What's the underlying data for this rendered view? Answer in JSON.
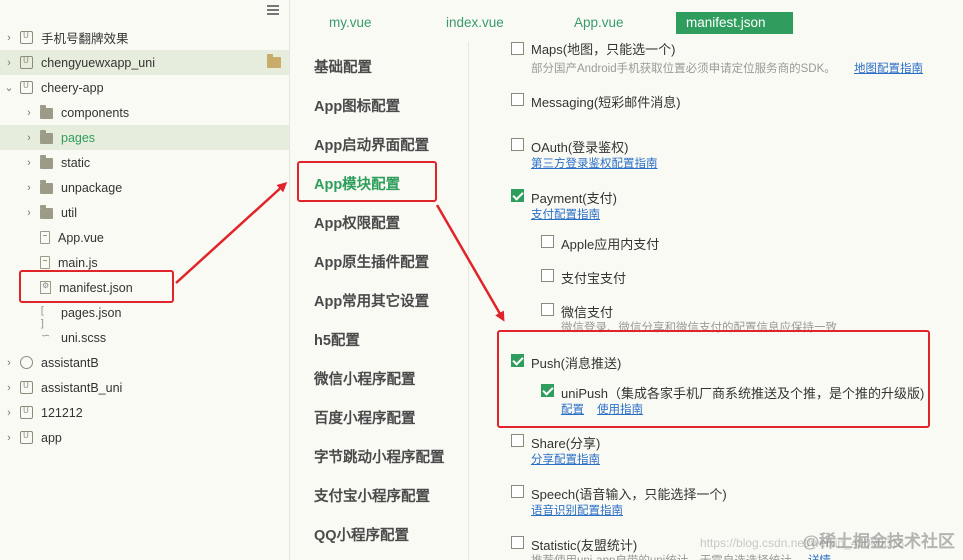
{
  "tree": {
    "items": [
      {
        "label": "手机号翻牌效果",
        "icon": "project-icon",
        "expanded": false
      },
      {
        "label": "chengyuewxapp_uni",
        "icon": "project-icon",
        "expanded": false
      },
      {
        "label": "cheery-app",
        "icon": "project-icon",
        "expanded": true
      },
      {
        "label": "components",
        "icon": "folder-icon"
      },
      {
        "label": "pages",
        "icon": "folder-icon"
      },
      {
        "label": "static",
        "icon": "folder-icon"
      },
      {
        "label": "unpackage",
        "icon": "folder-icon"
      },
      {
        "label": "util",
        "icon": "folder-icon"
      },
      {
        "label": "App.vue",
        "icon": "vue-file-icon"
      },
      {
        "label": "main.js",
        "icon": "js-file-icon"
      },
      {
        "label": "manifest.json",
        "icon": "manifest-file-icon"
      },
      {
        "label": "pages.json",
        "icon": "json-file-icon"
      },
      {
        "label": "uni.scss",
        "icon": "scss-file-icon"
      },
      {
        "label": "assistantB",
        "icon": "project-icon"
      },
      {
        "label": "assistantB_uni",
        "icon": "project-icon"
      },
      {
        "label": "121212",
        "icon": "project-icon"
      },
      {
        "label": "app",
        "icon": "project-icon"
      }
    ]
  },
  "tabs": [
    {
      "label": "my.vue"
    },
    {
      "label": "index.vue"
    },
    {
      "label": "App.vue"
    },
    {
      "label": "manifest.json",
      "active": true
    }
  ],
  "categories": [
    "基础配置",
    "App图标配置",
    "App启动界面配置",
    "App模块配置",
    "App权限配置",
    "App原生插件配置",
    "App常用其它设置",
    "h5配置",
    "微信小程序配置",
    "百度小程序配置",
    "字节跳动小程序配置",
    "支付宝小程序配置",
    "QQ小程序配置"
  ],
  "modules": {
    "maps": {
      "label": "Maps(地图，只能选一个)",
      "checked": false,
      "desc": "部分国产Android手机获取位置必须申请定位服务商的SDK。",
      "link": "地图配置指南"
    },
    "messaging": {
      "label": "Messaging(短彩邮件消息)",
      "checked": false
    },
    "oauth": {
      "label": "OAuth(登录鉴权)",
      "checked": false,
      "link": "第三方登录鉴权配置指南"
    },
    "payment": {
      "label": "Payment(支付)",
      "checked": true,
      "link": "支付配置指南"
    },
    "apple_pay": {
      "label": "Apple应用内支付",
      "checked": false
    },
    "alipay": {
      "label": "支付宝支付",
      "checked": false
    },
    "wechat_pay": {
      "label": "微信支付",
      "checked": false,
      "desc": "微信登录、微信分享和微信支付的配置信息应保持一致"
    },
    "push": {
      "label": "Push(消息推送)",
      "checked": true
    },
    "unipush": {
      "label": "uniPush（集成各家手机厂商系统推送及个推，是个推的升级版)",
      "checked": true,
      "link1": "配置",
      "link2": "使用指南"
    },
    "share": {
      "label": "Share(分享)",
      "checked": false,
      "link": "分享配置指南"
    },
    "speech": {
      "label": "Speech(语音输入，只能选择一个)",
      "checked": false,
      "link": "语音识别配置指南"
    },
    "statistic": {
      "label": "Statistic(友盟统计)",
      "checked": false,
      "desc": "推荐使用uni-app自带的uni统计，无需自选选择统计，",
      "link": "详情"
    }
  },
  "watermark": {
    "main": "@稀土掘金技术社区",
    "sub": "https://blog.csdn.net/weixin_45000018"
  },
  "colors": {
    "accent": "#2f9d5e",
    "annotation": "#e0242a",
    "link": "#2a6fc6"
  }
}
